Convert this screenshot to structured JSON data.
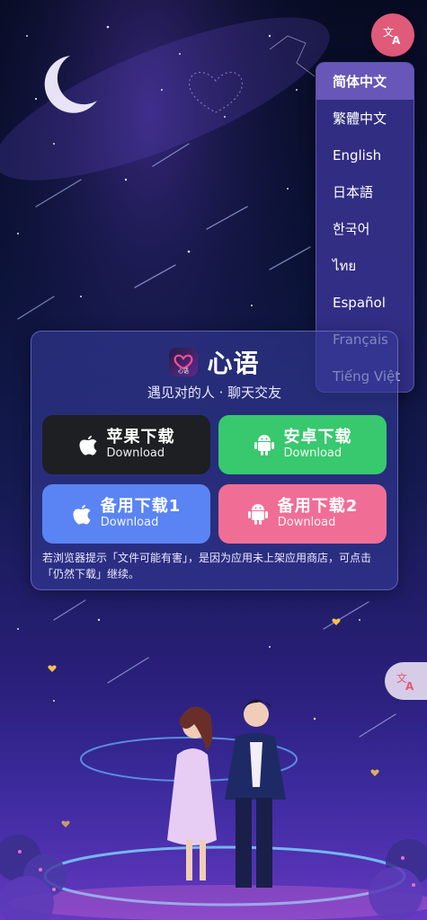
{
  "language_menu": {
    "items": [
      "简体中文",
      "繁體中文",
      "English",
      "日本語",
      "한국어",
      "ไทย",
      "Español",
      "Français",
      "Tiếng Việt"
    ],
    "selected": "简体中文"
  },
  "brand": {
    "logo_text": "心语",
    "name": "心语",
    "tagline": "遇见对的人 · 聊天交友"
  },
  "downloads": {
    "apple": {
      "label": "苹果下载",
      "sub": "Download",
      "icon": "apple-icon"
    },
    "android": {
      "label": "安卓下载",
      "sub": "Download",
      "icon": "android-icon"
    },
    "backup1": {
      "label": "备用下载1",
      "sub": "Download",
      "icon": "apple-icon"
    },
    "backup2": {
      "label": "备用下载2",
      "sub": "Download",
      "icon": "android-icon"
    }
  },
  "note": "若浏览器提示「文件可能有害」，是因为应用未上架应用商店，可点击「仍然下载」继续。",
  "colors": {
    "accent_pink": "#e05a7a",
    "apple_button": "#1e1f22",
    "android_button": "#38c86e",
    "backup1_button": "#5a84f4",
    "backup2_button": "#f06e96"
  }
}
